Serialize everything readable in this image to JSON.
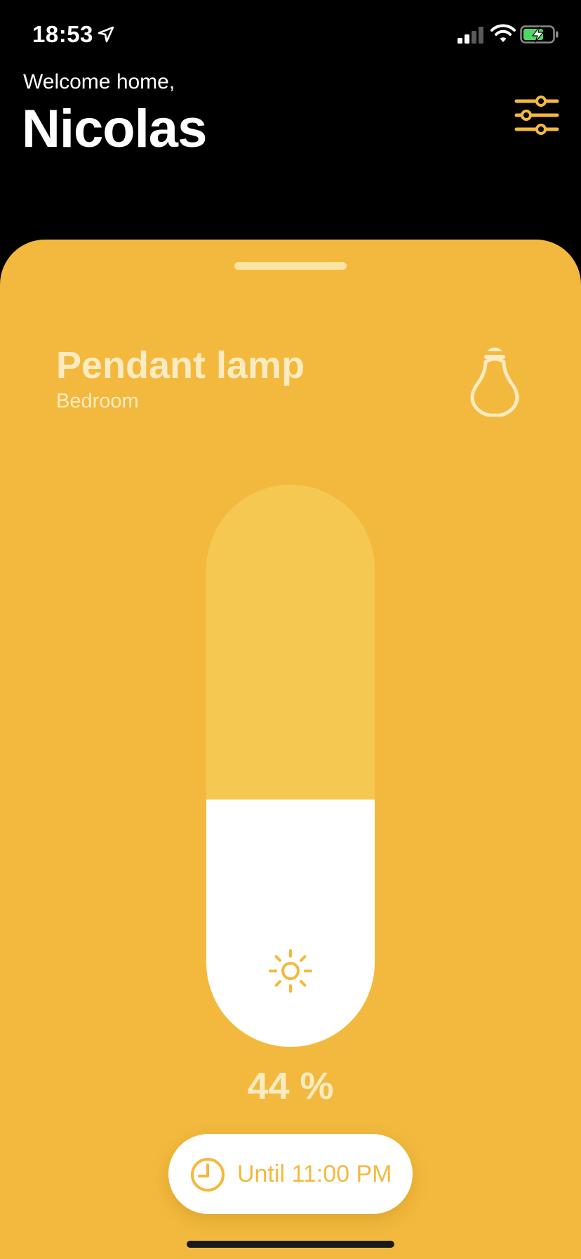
{
  "status_bar": {
    "time": "18:53",
    "icons": [
      "location-arrow-icon",
      "cellular-signal-icon",
      "wifi-icon",
      "battery-charging-icon"
    ]
  },
  "header": {
    "greeting": "Welcome home,",
    "user_name": "Nicolas",
    "settings_icon": "sliders-icon"
  },
  "device": {
    "name": "Pendant lamp",
    "room": "Bedroom",
    "icon": "light-bulb-icon"
  },
  "brightness": {
    "value": 44,
    "label": "44 %",
    "icon": "sun-icon"
  },
  "timer": {
    "label": "Until 11:00 PM",
    "icon": "clock-icon"
  },
  "colors": {
    "background": "#000000",
    "card": "#F3B93E",
    "slider_track": "#F5C951",
    "slider_fill": "#FFFFFF",
    "text_on_card": "#FCEBC1",
    "accent": "#F3B93E"
  }
}
